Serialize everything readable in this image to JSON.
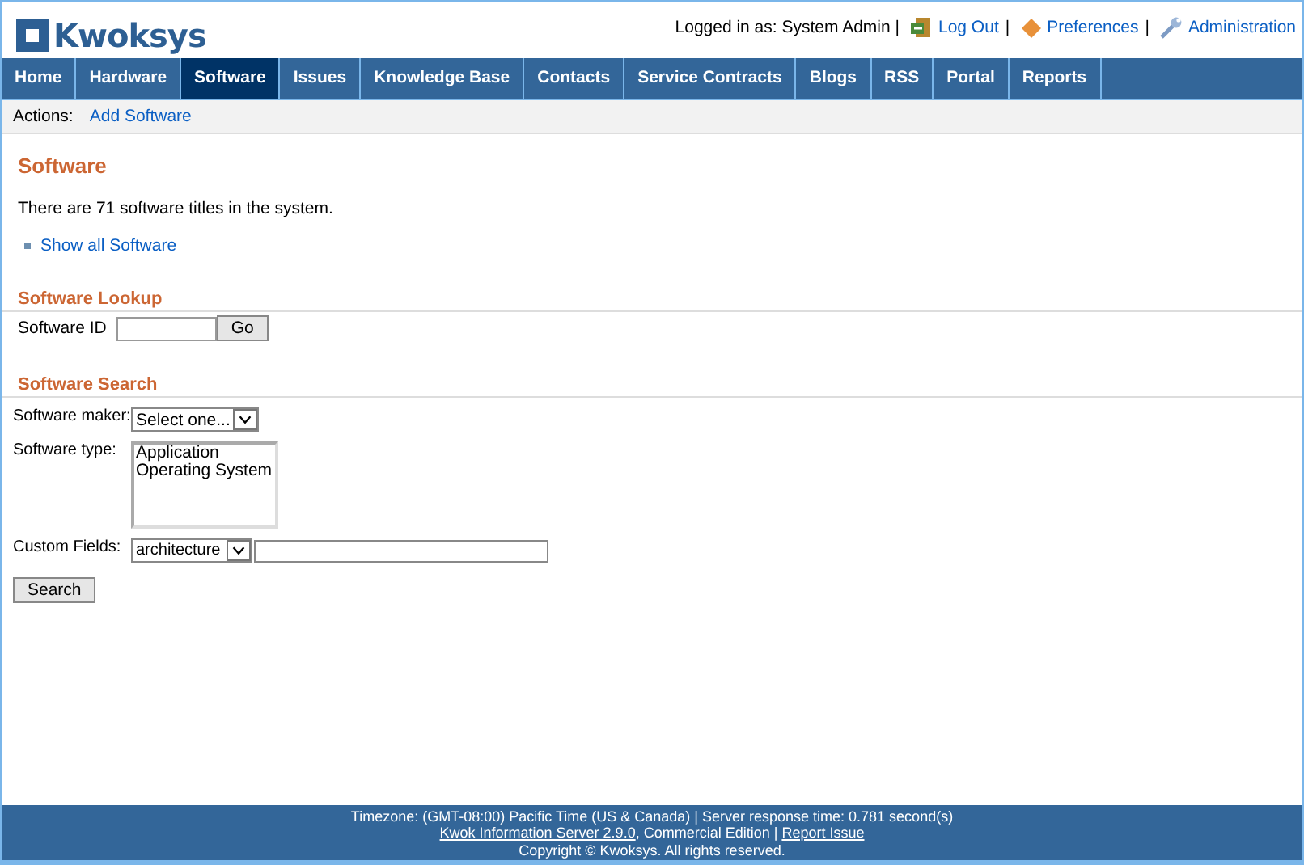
{
  "logo": {
    "text": "Kwoksys"
  },
  "user_bar": {
    "logged_in": "Logged in as: System Admin |",
    "separator": "|",
    "links": [
      {
        "kind": "logout",
        "label": "Log Out"
      },
      {
        "kind": "preferences",
        "label": "Preferences"
      },
      {
        "kind": "admin",
        "label": "Administration"
      }
    ]
  },
  "nav": [
    {
      "label": "Home",
      "selected": false
    },
    {
      "label": "Hardware",
      "selected": false
    },
    {
      "label": "Software",
      "selected": true
    },
    {
      "label": "Issues",
      "selected": false
    },
    {
      "label": "Knowledge Base",
      "selected": false
    },
    {
      "label": "Contacts",
      "selected": false
    },
    {
      "label": "Service Contracts",
      "selected": false
    },
    {
      "label": "Blogs",
      "selected": false
    },
    {
      "label": "RSS",
      "selected": false
    },
    {
      "label": "Portal",
      "selected": false
    },
    {
      "label": "Reports",
      "selected": false
    }
  ],
  "actions": {
    "label": "Actions:",
    "links": [
      "Add Software"
    ]
  },
  "title": "Software",
  "summary": "There are 71 software titles in the system.",
  "list_links": [
    "Show all Software"
  ],
  "lookup": {
    "heading": "Software Lookup",
    "label": "Software ID",
    "button": "Go"
  },
  "search": {
    "heading": "Software Search",
    "maker_label": "Software maker:",
    "maker_value": "Select one...",
    "type_label": "Software type:",
    "types": [
      "Application",
      "Operating System"
    ],
    "custom_label": "Custom Fields:",
    "custom_value": "architecture",
    "button": "Search"
  },
  "footer": {
    "line1": "Timezone: (GMT-08:00) Pacific Time (US & Canada) | Server response time: 0.781 second(s)",
    "product_link": "Kwok Information Server 2.9.0",
    "edition": ", Commercial Edition | ",
    "report_link": "Report Issue",
    "copyright": "Copyright © Kwoksys. All rights reserved."
  }
}
